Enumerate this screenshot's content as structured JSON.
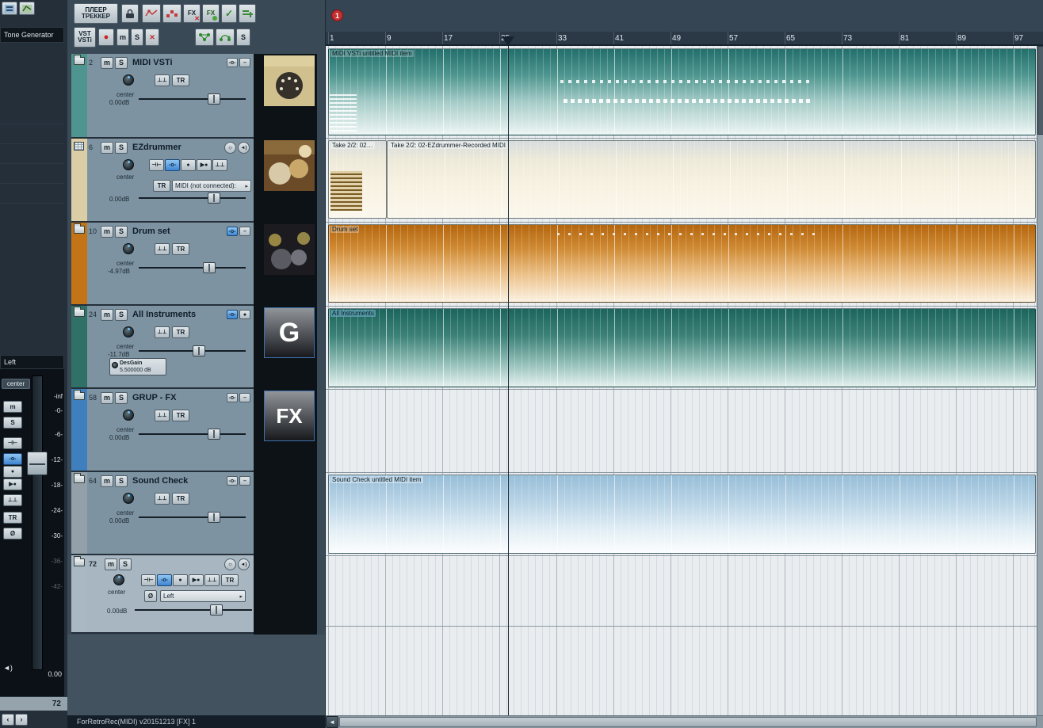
{
  "statusbar": {
    "text": "ForRetroRec(MIDI) v20151213 [FX] 1"
  },
  "toolbar": {
    "player_tracker_l1": "ПЛЕЕР",
    "player_tracker_l2": "ТРЕККЕР",
    "vst_l1": "VST",
    "vst_l2": "VSTi",
    "fx_bypass": "FX",
    "fx_on": "FX",
    "check": "✓",
    "x": "✕",
    "record": "●",
    "mute": "m",
    "solo": "S",
    "solo2": "S"
  },
  "master": {
    "name": "Tone Generator",
    "routing": "Left",
    "pan": "center",
    "db_scale": [
      "-inf",
      "-0-",
      "-6-",
      "-12-",
      "-18-",
      "-24-",
      "-30-",
      "-36-",
      "-42-"
    ],
    "mute": "m",
    "solo": "S",
    "env1": "⊣⊢",
    "env2": "-o-",
    "rec": "●",
    "mon": "▶●",
    "ch": "⊥⊥",
    "tr": "TR",
    "phase": "Ø",
    "speaker": "◄)",
    "value": "0.00",
    "row_number": "72"
  },
  "scroll": {
    "left": "‹",
    "right": "›",
    "h_arrow": "◄"
  },
  "tracks": [
    {
      "number": "2",
      "name": "MIDI VSTi",
      "mute": "m",
      "solo": "S",
      "env": "-o-",
      "fxm": "–",
      "ch": "⊥⊥",
      "tr": "TR",
      "pan": "center",
      "volume": "0.00dB",
      "color": "#4e948f"
    },
    {
      "number": "6",
      "name": "EZdrummer",
      "mute": "m",
      "solo": "S",
      "rec": "○",
      "spk": "◄)",
      "env1": "⊣⊢",
      "env2": "-o-",
      "rec2": "●",
      "mon": "▶●",
      "ch": "⊥⊥",
      "tr": "TR",
      "midi_input": "MIDI (not connected):",
      "arrow": "▸",
      "pan": "center",
      "volume": "0.00dB",
      "color": "#dbcda6"
    },
    {
      "number": "10",
      "name": "Drum set",
      "mute": "m",
      "solo": "S",
      "env": "-o-",
      "fxm": "–",
      "ch": "⊥⊥",
      "tr": "TR",
      "pan": "center",
      "volume": "-4.97dB",
      "color": "#c47317"
    },
    {
      "number": "24",
      "name": "All Instruments",
      "mute": "m",
      "solo": "S",
      "env": "-o-",
      "fxm": "●",
      "ch": "⊥⊥",
      "tr": "TR",
      "pan": "center",
      "volume": "-11.7dB",
      "fx_name": "DesGain",
      "fx_value": "5.500000 dB",
      "color": "#2f7167",
      "badge": "G"
    },
    {
      "number": "58",
      "name": "GRUP - FX",
      "mute": "m",
      "solo": "S",
      "env": "-o-",
      "fxm": "–",
      "ch": "⊥⊥",
      "tr": "TR",
      "pan": "center",
      "volume": "0.00dB",
      "color": "#3f7fbe",
      "badge": "FX"
    },
    {
      "number": "64",
      "name": "Sound Check",
      "mute": "m",
      "solo": "S",
      "env": "-o-",
      "fxm": "–",
      "ch": "⊥⊥",
      "tr": "TR",
      "pan": "center",
      "volume": "0.00dB",
      "color": "#93a0aa"
    },
    {
      "number": "72",
      "name": "",
      "mute": "m",
      "solo": "S",
      "rec": "○",
      "spk": "◄)",
      "env1": "⊣⊢",
      "env2": "-o-",
      "rec2": "●",
      "mon": "▶●",
      "ch": "⊥⊥",
      "tr": "TR",
      "phase": "Ø",
      "routing": "Left",
      "arrow": "▸",
      "pan": "center",
      "volume": "0.00dB",
      "color": "#a9b8c2"
    }
  ],
  "ruler": {
    "marker": "1",
    "ticks": [
      "1",
      "9",
      "17",
      "25",
      "33",
      "41",
      "49",
      "57",
      "65",
      "73",
      "81",
      "89",
      "97"
    ]
  },
  "items": {
    "midi_vsti": "MIDI VSTi untitled MIDI item",
    "take1": "Take 2/2: 02…",
    "take2": "Take 2/2: 02-EZdrummer-Recorded MIDI",
    "drum_set": "Drum set",
    "all_instruments": "All Instruments",
    "sound_check": "Sound Check untitled MIDI item"
  },
  "item_colors": {
    "midi_vsti": "#2a7a76",
    "ezdrummer": "#f3ecd9",
    "drum_set": "#bf6f15",
    "all_instruments": "#20685e",
    "sound_check": "#a4c6dc",
    "accent_blue": "#4a90d9",
    "marker_red": "#c52f2f"
  }
}
